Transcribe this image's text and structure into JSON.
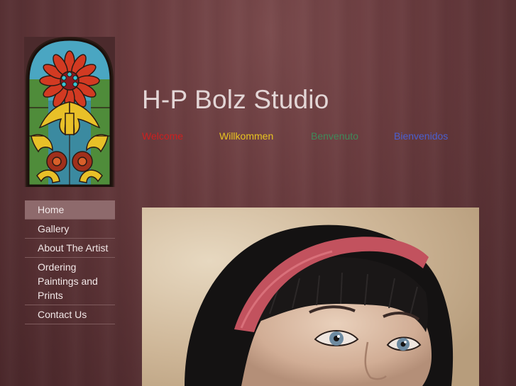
{
  "site": {
    "title": "H-P Bolz Studio"
  },
  "greetings": [
    {
      "text": "Welcome",
      "color": "#cc1f1f"
    },
    {
      "text": "Willkommen",
      "color": "#e8c420"
    },
    {
      "text": "Benvenuto",
      "color": "#3e8a5a"
    },
    {
      "text": "Bienvenidos",
      "color": "#4a5fd0"
    }
  ],
  "nav": {
    "items": [
      {
        "label": "Home",
        "active": true
      },
      {
        "label": "Gallery"
      },
      {
        "label": "About The Artist"
      },
      {
        "label": "Ordering Paintings and Prints"
      },
      {
        "label": "Contact Us"
      }
    ]
  },
  "colors": {
    "background": "#5b3336",
    "title": "#e3d6d6",
    "nav_active": "#8e6a6c",
    "nav_divider": "#7e5a5c"
  },
  "icons": {
    "logo": "stained-glass-window-icon"
  }
}
